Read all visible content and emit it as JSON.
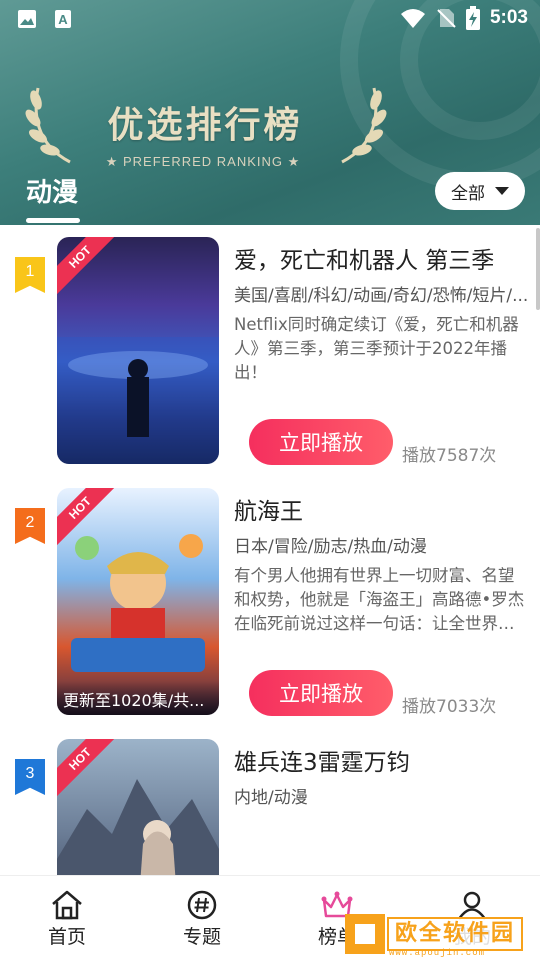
{
  "status_bar": {
    "time": "5:03",
    "icons": [
      "image-icon",
      "font-icon",
      "wifi-icon",
      "no-sim-icon",
      "battery-charging-icon"
    ]
  },
  "header": {
    "banner_title": "优选排行榜",
    "banner_subtitle": "★ PREFERRED RANKING ★",
    "active_tab": "动漫",
    "filter_label": "全部"
  },
  "list": {
    "items": [
      {
        "rank": "1",
        "rank_color": "#f9c519",
        "hot_label": "HOT",
        "title": "爱，死亡和机器人 第三季",
        "tags": "美国/喜剧/科幻/动画/奇幻/恐怖/短片/...",
        "desc": "Netflix同时确定续订《爱，死亡和机器人》第三季，第三季预计于2022年播出！",
        "play_label": "立即播放",
        "plays": "播放7587次",
        "poster_caption": ""
      },
      {
        "rank": "2",
        "rank_color": "#f46d1c",
        "hot_label": "HOT",
        "title": "航海王",
        "tags": "日本/冒险/励志/热血/动漫",
        "desc": "有个男人他拥有世界上一切财富、名望和权势，他就是「海盗王」高路德•罗杰在临死前说过这样一句话：让全世界的人都奔向大海「想要我的财宝吗？",
        "play_label": "立即播放",
        "plays": "播放7033次",
        "poster_caption": "更新至1020集/共..."
      },
      {
        "rank": "3",
        "rank_color": "#1f78d8",
        "hot_label": "HOT",
        "title": "雄兵连3雷霆万钧",
        "tags": "内地/动漫",
        "desc": "",
        "play_label": "",
        "plays": "",
        "poster_caption": ""
      }
    ]
  },
  "bottom_nav": {
    "items": [
      {
        "label": "首页",
        "icon": "home-icon"
      },
      {
        "label": "专题",
        "icon": "hashtag-icon"
      },
      {
        "label": "榜单",
        "icon": "crown-icon"
      },
      {
        "label": "我的",
        "icon": "user-icon"
      }
    ],
    "active_index": 2,
    "active_color": "#e64a9a"
  },
  "watermark": {
    "text": "欧全软件园",
    "url": "www.apoujin.com"
  }
}
